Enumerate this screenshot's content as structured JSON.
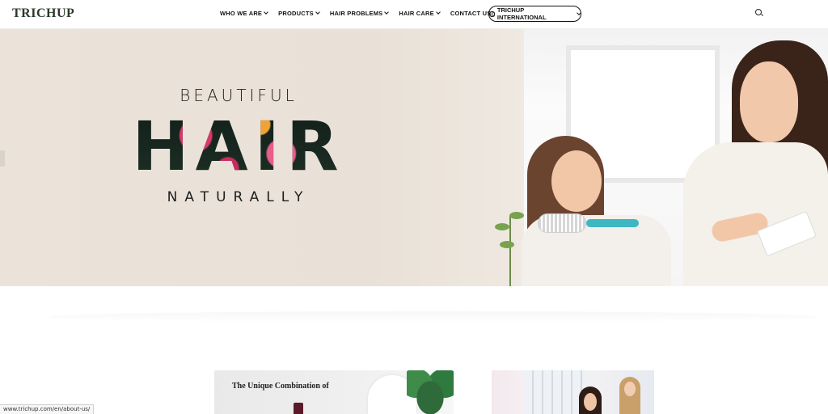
{
  "header": {
    "logo": "TRICHUP",
    "nav": [
      {
        "label": "WHO WE ARE",
        "has_dropdown": true
      },
      {
        "label": "PRODUCTS",
        "has_dropdown": true
      },
      {
        "label": "HAIR PROBLEMS",
        "has_dropdown": true
      },
      {
        "label": "HAIR CARE",
        "has_dropdown": true
      },
      {
        "label": "CONTACT US",
        "has_dropdown": false
      }
    ],
    "international_label": "TRICHUP INTERNATIONAL",
    "icons": {
      "search": "search-icon",
      "globe": "globe-icon",
      "dropdown": "chevron-down-icon"
    }
  },
  "hero": {
    "line1": "BEAUTIFUL",
    "line2": "HAIR",
    "line3": "NATURALLY"
  },
  "cards": {
    "card1_title": "The Unique Combination of"
  },
  "status_bar": {
    "url": "www.trichup.com/en/about-us/"
  },
  "colors": {
    "brand_dark_green": "#2c3a2a",
    "hero_beige": "#ebe3da",
    "text_dark": "#111111"
  }
}
